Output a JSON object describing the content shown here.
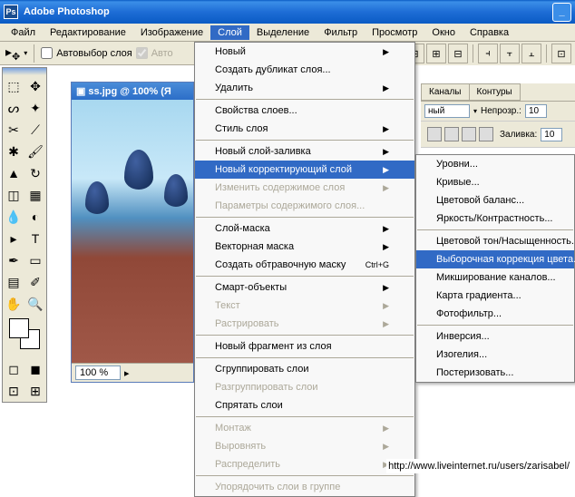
{
  "app_title": "Adobe Photoshop",
  "menubar": [
    "Файл",
    "Редактирование",
    "Изображение",
    "Слой",
    "Выделение",
    "Фильтр",
    "Просмотр",
    "Окно",
    "Справка"
  ],
  "active_menu_index": 3,
  "toolbar": {
    "auto_select_label": "Автовыбор слоя",
    "auto_select2": "Авто"
  },
  "document": {
    "title": "ss.jpg @ 100% (Я",
    "zoom": "100 %"
  },
  "layer_menu": [
    {
      "label": "Новый",
      "arrow": true
    },
    {
      "label": "Создать дубликат слоя..."
    },
    {
      "label": "Удалить",
      "arrow": true
    },
    {
      "sep": true
    },
    {
      "label": "Свойства слоев..."
    },
    {
      "label": "Стиль слоя",
      "arrow": true
    },
    {
      "sep": true
    },
    {
      "label": "Новый слой-заливка",
      "arrow": true
    },
    {
      "label": "Новый корректирующий слой",
      "arrow": true,
      "hl": true
    },
    {
      "label": "Изменить содержимое слоя",
      "arrow": true,
      "disabled": true
    },
    {
      "label": "Параметры содержимого слоя...",
      "disabled": true
    },
    {
      "sep": true
    },
    {
      "label": "Слой-маска",
      "arrow": true
    },
    {
      "label": "Векторная маска",
      "arrow": true
    },
    {
      "label": "Создать обтравочную маску",
      "shortcut": "Ctrl+G"
    },
    {
      "sep": true
    },
    {
      "label": "Смарт-объекты",
      "arrow": true
    },
    {
      "label": "Текст",
      "arrow": true,
      "disabled": true
    },
    {
      "label": "Растрировать",
      "arrow": true,
      "disabled": true
    },
    {
      "sep": true
    },
    {
      "label": "Новый фрагмент из слоя"
    },
    {
      "sep": true
    },
    {
      "label": "Сгруппировать слои"
    },
    {
      "label": "Разгруппировать слои",
      "disabled": true
    },
    {
      "label": "Спрятать слои"
    },
    {
      "sep": true
    },
    {
      "label": "Монтаж",
      "arrow": true,
      "disabled": true
    },
    {
      "label": "Выровнять",
      "arrow": true,
      "disabled": true
    },
    {
      "label": "Распределить",
      "arrow": true,
      "disabled": true
    },
    {
      "sep": true
    },
    {
      "label": "Упорядочить слои в группе",
      "disabled": true
    }
  ],
  "submenu": [
    {
      "label": "Уровни..."
    },
    {
      "label": "Кривые..."
    },
    {
      "label": "Цветовой баланс..."
    },
    {
      "label": "Яркость/Контрастность..."
    },
    {
      "sep": true
    },
    {
      "label": "Цветовой тон/Насыщенность..."
    },
    {
      "label": "Выборочная коррекция цвета...",
      "hl": true
    },
    {
      "label": "Микширование каналов..."
    },
    {
      "label": "Карта градиента..."
    },
    {
      "label": "Фотофильтр..."
    },
    {
      "sep": true
    },
    {
      "label": "Инверсия..."
    },
    {
      "label": "Изогелия..."
    },
    {
      "label": "Постеризовать..."
    }
  ],
  "panels": {
    "tabs": [
      "Каналы",
      "Контуры"
    ],
    "mode": "ный",
    "opacity_label": "Непрозр.:",
    "opacity_val": "10",
    "fill_label": "Заливка:",
    "fill_val": "10"
  },
  "footer_url": "http://www.liveinternet.ru/users/zarisabel/"
}
